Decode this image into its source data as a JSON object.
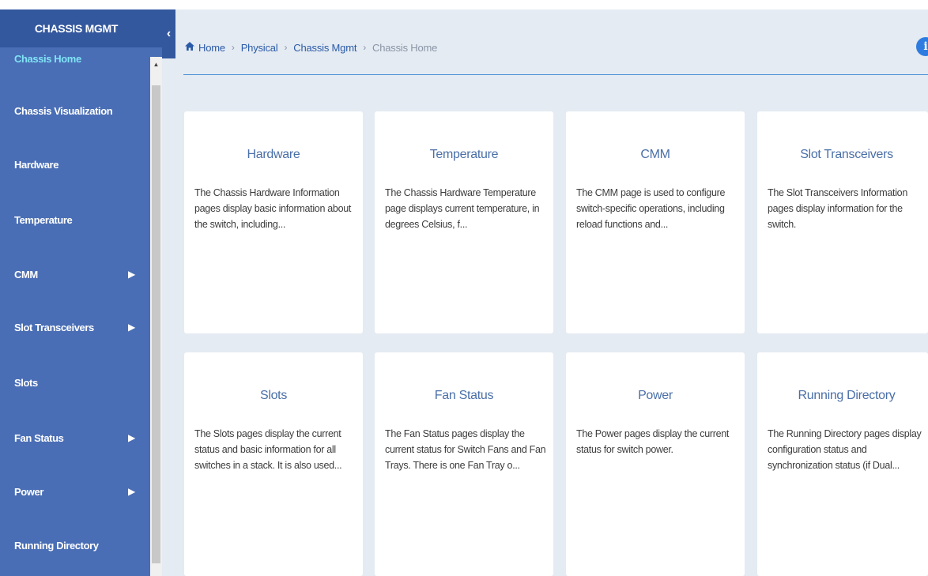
{
  "sidebar": {
    "title": "CHASSIS MGMT",
    "collapse_glyph": "‹",
    "items": [
      {
        "label": "Chassis Home",
        "active": true,
        "has_submenu": false
      },
      {
        "label": "Chassis Visualization",
        "active": false,
        "has_submenu": false
      },
      {
        "label": "Hardware",
        "active": false,
        "has_submenu": false
      },
      {
        "label": "Temperature",
        "active": false,
        "has_submenu": false
      },
      {
        "label": "CMM",
        "active": false,
        "has_submenu": true
      },
      {
        "label": "Slot Transceivers",
        "active": false,
        "has_submenu": true
      },
      {
        "label": "Slots",
        "active": false,
        "has_submenu": false
      },
      {
        "label": "Fan Status",
        "active": false,
        "has_submenu": true
      },
      {
        "label": "Power",
        "active": false,
        "has_submenu": true
      },
      {
        "label": "Running Directory",
        "active": false,
        "has_submenu": false
      }
    ]
  },
  "breadcrumb": {
    "home_icon": "home-icon",
    "items": [
      {
        "label": "Home",
        "link": true
      },
      {
        "label": "Physical",
        "link": true
      },
      {
        "label": "Chassis Mgmt",
        "link": true
      },
      {
        "label": "Chassis Home",
        "link": false
      }
    ],
    "separator": "›"
  },
  "info_button": {
    "glyph": "i"
  },
  "cards": [
    {
      "title": "Hardware",
      "desc": "The Chassis Hardware Information pages display basic information about the switch, including..."
    },
    {
      "title": "Temperature",
      "desc": "The Chassis Hardware Temperature page displays current temperature, in degrees Celsius, f..."
    },
    {
      "title": "CMM",
      "desc": "The CMM page is used to configure switch-specific operations, including reload functions and..."
    },
    {
      "title": "Slot Transceivers",
      "desc": "The Slot Transceivers Information pages display information for the switch."
    },
    {
      "title": "Slots",
      "desc": "The Slots pages display the current status and basic information for all switches in a stack. It is also used..."
    },
    {
      "title": "Fan Status",
      "desc": "The Fan Status pages display the current status for Switch Fans and Fan Trays. There is one Fan Tray o..."
    },
    {
      "title": "Power",
      "desc": "The Power pages display the current status for switch power."
    },
    {
      "title": "Running Directory",
      "desc": "The Running Directory pages display configuration status and synchronization status (if Dual..."
    }
  ],
  "colors": {
    "sidebar_bg": "#4a6eb5",
    "sidebar_header_bg": "#34589e",
    "active_item": "#7fe3f5",
    "content_bg": "#e4ebf2",
    "link": "#2b5aa8",
    "card_title": "#4a6fa8"
  }
}
